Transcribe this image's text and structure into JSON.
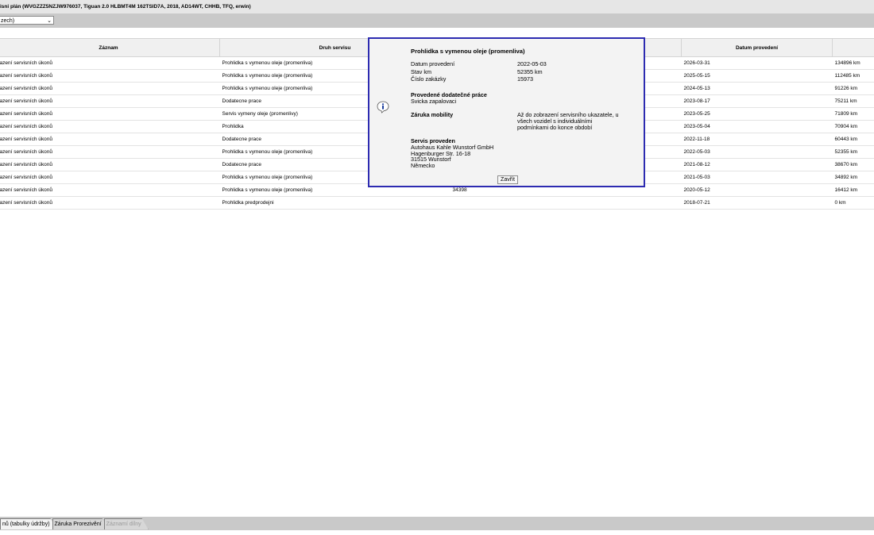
{
  "window": {
    "title": "isni plán (WVGZZZ5NZJW976037, Tiguan 2.0 HLBMT4M 162TSID7A, 2018, AD14WT, CHHB, TFQ, erwin)"
  },
  "filter": {
    "selected": "zech)"
  },
  "table": {
    "headers": [
      "Záznam",
      "Druh servisu",
      "",
      "Datum provedení",
      ""
    ],
    "rows": [
      {
        "zaznam": "azení servisních úkonů",
        "druh": "Prohlidka s vymenou oleje (promenliva)",
        "cislo": "",
        "datum": "2026-03-31",
        "km": "134896 km"
      },
      {
        "zaznam": "azení servisních úkonů",
        "druh": "Prohlidka s vymenou oleje (promenliva)",
        "cislo": "",
        "datum": "2025-05-15",
        "km": "112485 km"
      },
      {
        "zaznam": "azení servisních úkonů",
        "druh": "Prohlidka s vymenou oleje (promenliva)",
        "cislo": "",
        "datum": "2024-05-13",
        "km": "91226 km"
      },
      {
        "zaznam": "azení servisních úkonů",
        "druh": "Dodatecne prace",
        "cislo": "",
        "datum": "2023-08-17",
        "km": "75211 km"
      },
      {
        "zaznam": "azení servisních úkonů",
        "druh": "Servis vymeny oleje (promenlivy)",
        "cislo": "",
        "datum": "2023-05-25",
        "km": "71809 km"
      },
      {
        "zaznam": "azení servisních úkonů",
        "druh": "Prohlidka",
        "cislo": "",
        "datum": "2023-05-04",
        "km": "70904 km"
      },
      {
        "zaznam": "azení servisních úkonů",
        "druh": "Dodatecne prace",
        "cislo": "",
        "datum": "2022-11-18",
        "km": "60443 km"
      },
      {
        "zaznam": "azení servisních úkonů",
        "druh": "Prohlidka s vymenou oleje (promenliva)",
        "cislo": "",
        "datum": "2022-05-03",
        "km": "52355 km"
      },
      {
        "zaznam": "azení servisních úkonů",
        "druh": "Dodatecne prace",
        "cislo": "",
        "datum": "2021-08-12",
        "km": "38670 km"
      },
      {
        "zaznam": "azení servisních úkonů",
        "druh": "Prohlidka s vymenou oleje (promenliva)",
        "cislo": "",
        "datum": "2021-05-03",
        "km": "34892 km"
      },
      {
        "zaznam": "azení servisních úkonů",
        "druh": "Prohlidka s vymenou oleje (promenliva)",
        "cislo": "34398",
        "datum": "2020-05-12",
        "km": "16412 km"
      },
      {
        "zaznam": "azení servisních úkonů",
        "druh": "Prohlidka predprodejni",
        "cislo": "",
        "datum": "2018-07-21",
        "km": "0 km"
      }
    ]
  },
  "dialog": {
    "title": "Prohlidka s vymenou oleje (promenliva)",
    "datum_label": "Datum provedení",
    "datum_value": "2022-05-03",
    "km_label": "Stav km",
    "km_value": "52355 km",
    "zakazka_label": "Číslo zakázky",
    "zakazka_value": "15973",
    "dodatecne_title": "Provedené dodatečné práce",
    "dodatecne_value": "Svicka zapalovaci",
    "zaruka_title": "Záruka mobility",
    "zaruka_line1": "Až do zobrazení servisního ukazatele, u",
    "zaruka_line2": "všech vozidel s individuálními",
    "zaruka_line3": "podmínkami do konce období",
    "servis_title": "Servis proveden",
    "servis_line1": "Autohaus Kahle Wunstorf GmbH",
    "servis_line2": "Hagenburger Str. 16-18",
    "servis_line3": "31515 Wunstorf",
    "servis_line4": "Německo",
    "close_label": "Zavřít",
    "info_icon": "info-icon",
    "border_color": "#2d2bb1"
  },
  "tabs": [
    {
      "label": "nů (tabulky údržby)",
      "state": "active"
    },
    {
      "label": "Záruka Prorezivění",
      "state": "normal"
    },
    {
      "label": "Záznamí dílny",
      "state": "disabled"
    }
  ]
}
